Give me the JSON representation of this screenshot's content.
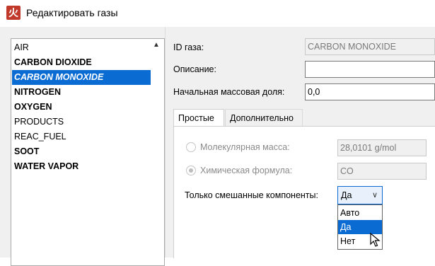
{
  "window": {
    "title": "Редактировать газы",
    "icon": "app-logo-icon"
  },
  "gas_list": {
    "items": [
      {
        "label": "AIR",
        "bold": false,
        "selected": false
      },
      {
        "label": "CARBON DIOXIDE",
        "bold": true,
        "selected": false
      },
      {
        "label": "CARBON MONOXIDE",
        "bold": true,
        "selected": true
      },
      {
        "label": "NITROGEN",
        "bold": true,
        "selected": false
      },
      {
        "label": "OXYGEN",
        "bold": true,
        "selected": false
      },
      {
        "label": "PRODUCTS",
        "bold": false,
        "selected": false
      },
      {
        "label": "REAC_FUEL",
        "bold": false,
        "selected": false
      },
      {
        "label": "SOOT",
        "bold": true,
        "selected": false
      },
      {
        "label": "WATER VAPOR",
        "bold": true,
        "selected": false
      }
    ]
  },
  "form": {
    "id_label": "ID газа:",
    "id_value": "CARBON MONOXIDE",
    "description_label": "Описание:",
    "description_value": "",
    "mass_fraction_label": "Начальная массовая доля:",
    "mass_fraction_value": "0,0"
  },
  "tabs": [
    {
      "label": "Простые",
      "active": true
    },
    {
      "label": "Дополнительно",
      "active": false
    }
  ],
  "simple": {
    "molecular_mass_label": "Молекулярная масса:",
    "molecular_mass_value": "28,0101 g/mol",
    "chemical_formula_label": "Химическая формула:",
    "chemical_formula_value": "CO",
    "mixed_only_label": "Только смешанные компоненты:",
    "mixed_only_value": "Да",
    "mixed_only_options": [
      "Авто",
      "Да",
      "Нет"
    ],
    "highlighted_option": "Да"
  },
  "colors": {
    "selection": "#0a6cd3",
    "panel": "#f0f0f0"
  }
}
